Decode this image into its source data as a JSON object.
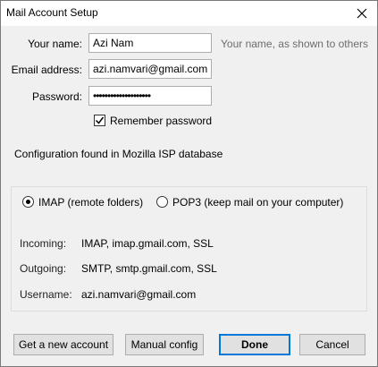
{
  "window": {
    "title": "Mail Account Setup"
  },
  "form": {
    "name_label": "Your name:",
    "name_value": "Azi Nam",
    "name_hint": "Your name, as shown to others",
    "email_label": "Email address:",
    "email_value": "azi.namvari@gmail.com",
    "password_label": "Password:",
    "password_value": "••••••••••••••••••••",
    "remember_label": "Remember password",
    "remember_checked": true
  },
  "config": {
    "message": "Configuration found in Mozilla ISP database"
  },
  "protocols": {
    "imap_label": "IMAP (remote folders)",
    "pop3_label": "POP3 (keep mail on your computer)",
    "selected": "imap"
  },
  "server_info": {
    "incoming_key": "Incoming:",
    "incoming_val": "IMAP, imap.gmail.com, SSL",
    "outgoing_key": "Outgoing:",
    "outgoing_val": "SMTP, smtp.gmail.com, SSL",
    "username_key": "Username:",
    "username_val": "azi.namvari@gmail.com"
  },
  "buttons": {
    "new_account": "Get a new account",
    "manual_config": "Manual config",
    "done": "Done",
    "cancel": "Cancel"
  }
}
